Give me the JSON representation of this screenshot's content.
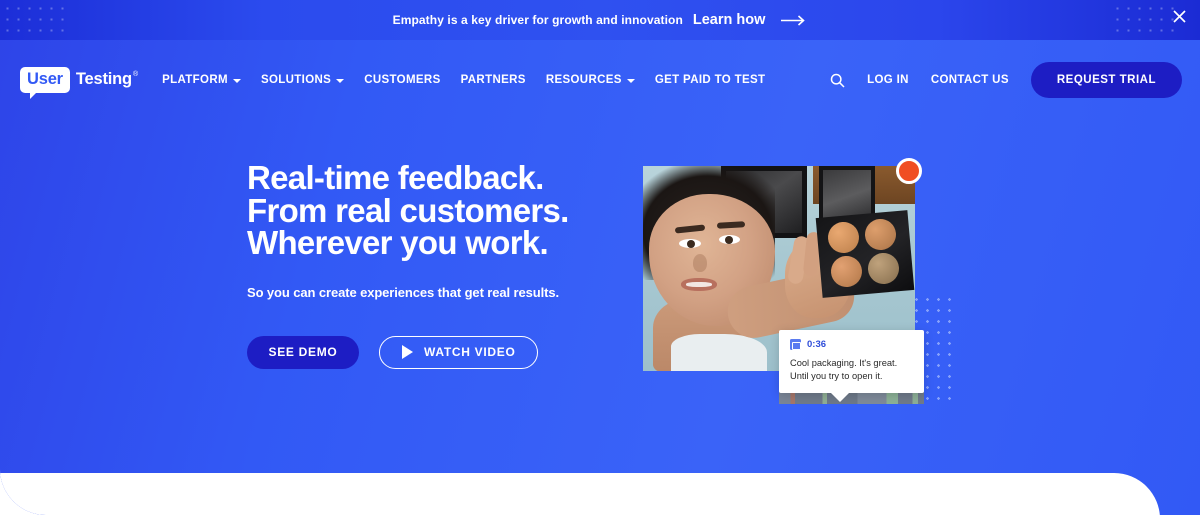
{
  "announcement": {
    "text": "Empathy is a key driver for growth and innovation",
    "link_label": "Learn how",
    "arrow_icon": "arrow-right-icon",
    "close_icon": "close-icon"
  },
  "brand": {
    "bubble_text": "User",
    "word": "Testing",
    "trademark": "®"
  },
  "nav": {
    "items": [
      {
        "label": "PLATFORM",
        "has_caret": true
      },
      {
        "label": "SOLUTIONS",
        "has_caret": true
      },
      {
        "label": "CUSTOMERS",
        "has_caret": false
      },
      {
        "label": "PARTNERS",
        "has_caret": false
      },
      {
        "label": "RESOURCES",
        "has_caret": true
      },
      {
        "label": "GET PAID TO TEST",
        "has_caret": false
      }
    ],
    "search_icon": "search-icon",
    "login_label": "LOG IN",
    "contact_label": "CONTACT US",
    "trial_label": "REQUEST TRIAL"
  },
  "hero": {
    "headline_line1": "Real-time feedback.",
    "headline_line2": "From real customers.",
    "headline_line3": "Wherever you work.",
    "subhead": "So you can create experiences that get real results.",
    "cta_primary": "SEE DEMO",
    "cta_secondary": "WATCH VIDEO",
    "play_icon": "play-icon"
  },
  "video": {
    "recording_indicator": "recording-dot",
    "comment": {
      "timestamp": "0:36",
      "timestamp_icon": "video-frame-icon",
      "line1": "Cool packaging. It's great.",
      "line2": "Until you try to open it."
    }
  },
  "colors": {
    "hero_blue": "#3259F5",
    "announce_blue": "#2B4BEE",
    "button_indigo": "#1D1DC4",
    "accent_orange": "#F04E23",
    "white": "#FFFFFF"
  }
}
